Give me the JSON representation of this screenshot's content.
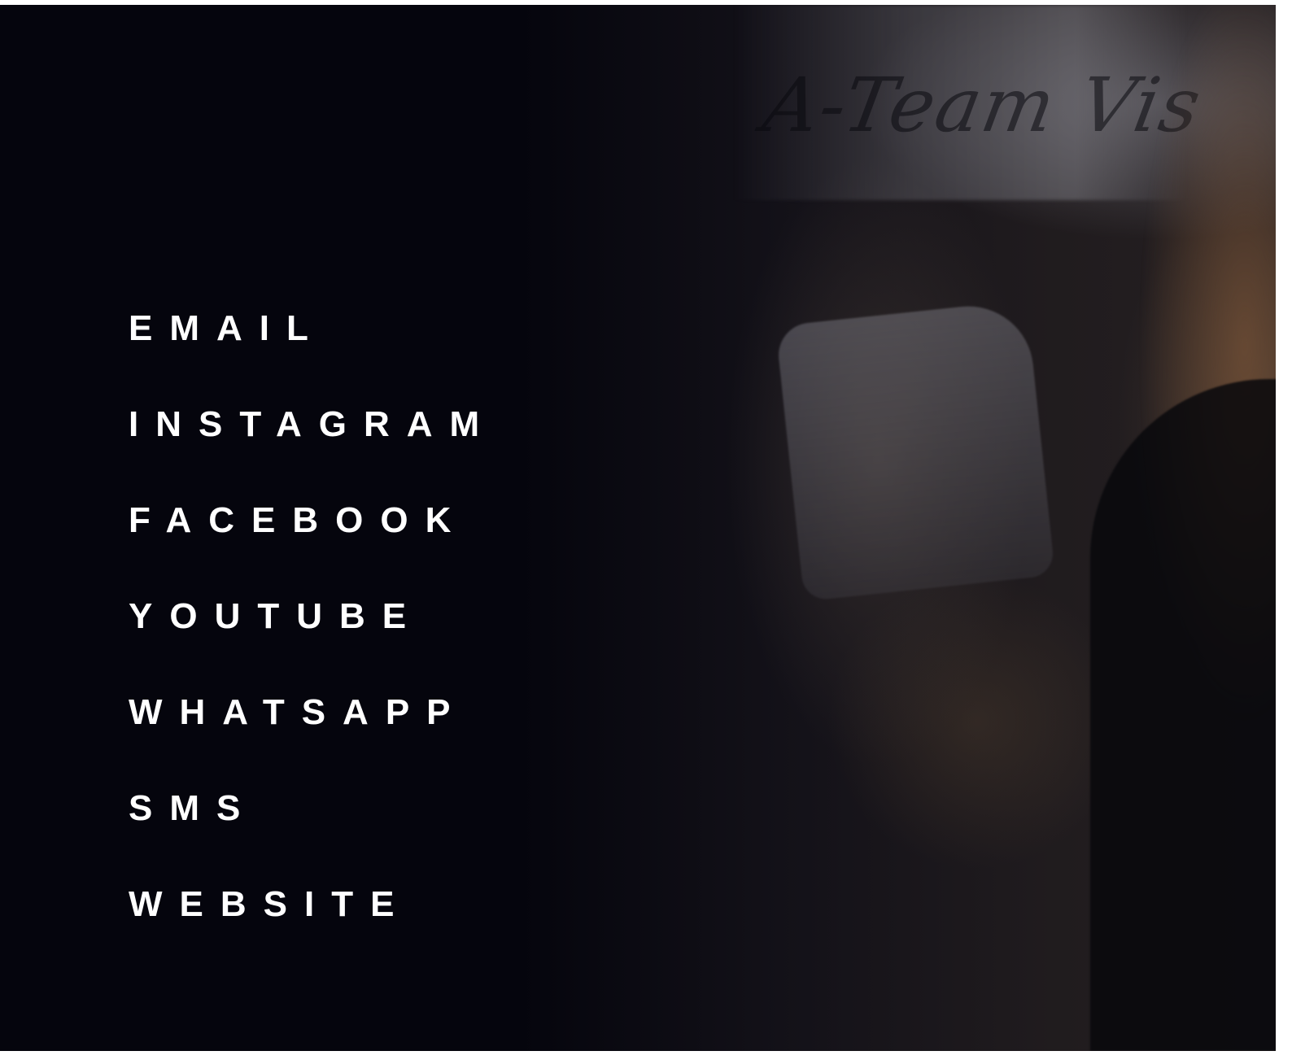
{
  "background": {
    "sign_text": "A-Team Vis",
    "overlay_color": "#05050d"
  },
  "menu": {
    "items": [
      {
        "label": "EMAIL"
      },
      {
        "label": "INSTAGRAM"
      },
      {
        "label": "FACEBOOK"
      },
      {
        "label": "YOUTUBE"
      },
      {
        "label": "WHATSAPP"
      },
      {
        "label": "SMS"
      },
      {
        "label": "WEBSITE"
      }
    ]
  }
}
